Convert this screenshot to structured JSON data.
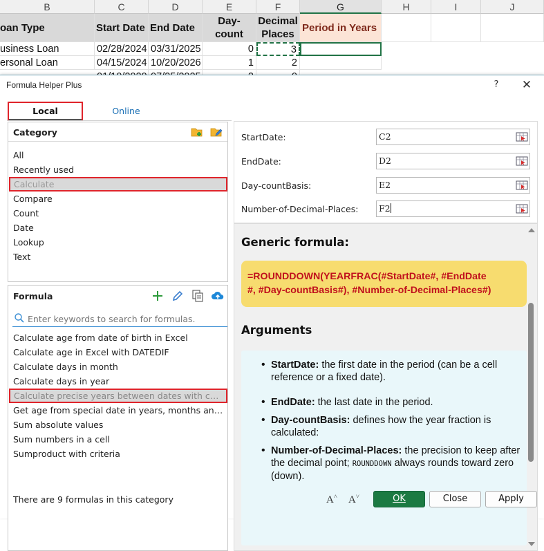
{
  "sheet": {
    "columns": [
      "B",
      "C",
      "D",
      "E",
      "F",
      "G",
      "H",
      "I",
      "J"
    ],
    "selected_column": "G",
    "header_row": [
      "oan Type",
      "Start Date",
      "End Date",
      "Day-count Basis",
      "Decimal Places",
      "Period in Years"
    ],
    "rows": [
      [
        "usiness Loan",
        "02/28/2024",
        "03/31/2025",
        "0",
        "3",
        ""
      ],
      [
        "ersonal Loan",
        "04/15/2024",
        "10/20/2026",
        "1",
        "2",
        ""
      ],
      [
        "",
        "01/10/2020",
        "07/25/2025",
        "2",
        "0",
        ""
      ]
    ]
  },
  "dialog": {
    "title": "Formula Helper Plus",
    "help": "?",
    "close": "✕"
  },
  "tabs": {
    "local": "Local",
    "online": "Online"
  },
  "category": {
    "title": "Category",
    "items": [
      "All",
      "Recently used",
      "Calculate",
      "Compare",
      "Count",
      "Date",
      "Lookup",
      "Text"
    ],
    "selected_index": 2
  },
  "formula": {
    "title": "Formula",
    "search_placeholder": "Enter keywords to search for formulas.",
    "items": [
      "Calculate age from date of birth in Excel",
      "Calculate age in Excel with DATEDIF",
      "Calculate days in month",
      "Calculate days in year",
      "Calculate precise years between dates with customizable options",
      "Get age from special date in years, months and days",
      "Sum absolute values",
      "Sum numbers in a cell",
      "Sumproduct with criteria"
    ],
    "selected_index": 4
  },
  "arguments": [
    {
      "label": "StartDate:",
      "value": "C2"
    },
    {
      "label": "EndDate:",
      "value": "D2"
    },
    {
      "label": "Day-countBasis:",
      "value": "E2"
    },
    {
      "label": "Number-of-Decimal-Places:",
      "value": "F2"
    }
  ],
  "help": {
    "generic_title": "Generic formula:",
    "formula_line1": "=ROUNDDOWN(YEARFRAC(#StartDate#, #EndDate",
    "formula_line2": "#, #Day-countBasis#), #Number-of-Decimal-Places#)",
    "arguments_title": "Arguments",
    "bullets": [
      {
        "term": "StartDate:",
        "desc": " the first date in the period (can be a cell reference or a fixed date)."
      },
      {
        "term": "EndDate:",
        "desc": " the last date in the period."
      },
      {
        "term": "Day-countBasis:",
        "desc": " defines how the year fraction is calculated:"
      },
      {
        "term": "Number-of-Decimal-Places:",
        "desc_pre": " the precision to keep after the decimal point; ",
        "code": "ROUNDDOWN",
        "desc_post": " always rounds toward zero (down)."
      }
    ]
  },
  "footer": {
    "status": "There are 9 formulas in this category",
    "font_up": "A",
    "font_down": "A",
    "ok": "OK",
    "close": "Close",
    "apply": "Apply"
  },
  "colors": {
    "accent_green": "#1b7a42",
    "highlight_red": "#e0242b",
    "formula_bg": "#f7dc6f",
    "formula_text": "#c0101d",
    "args_bg": "#e9f7fa"
  }
}
